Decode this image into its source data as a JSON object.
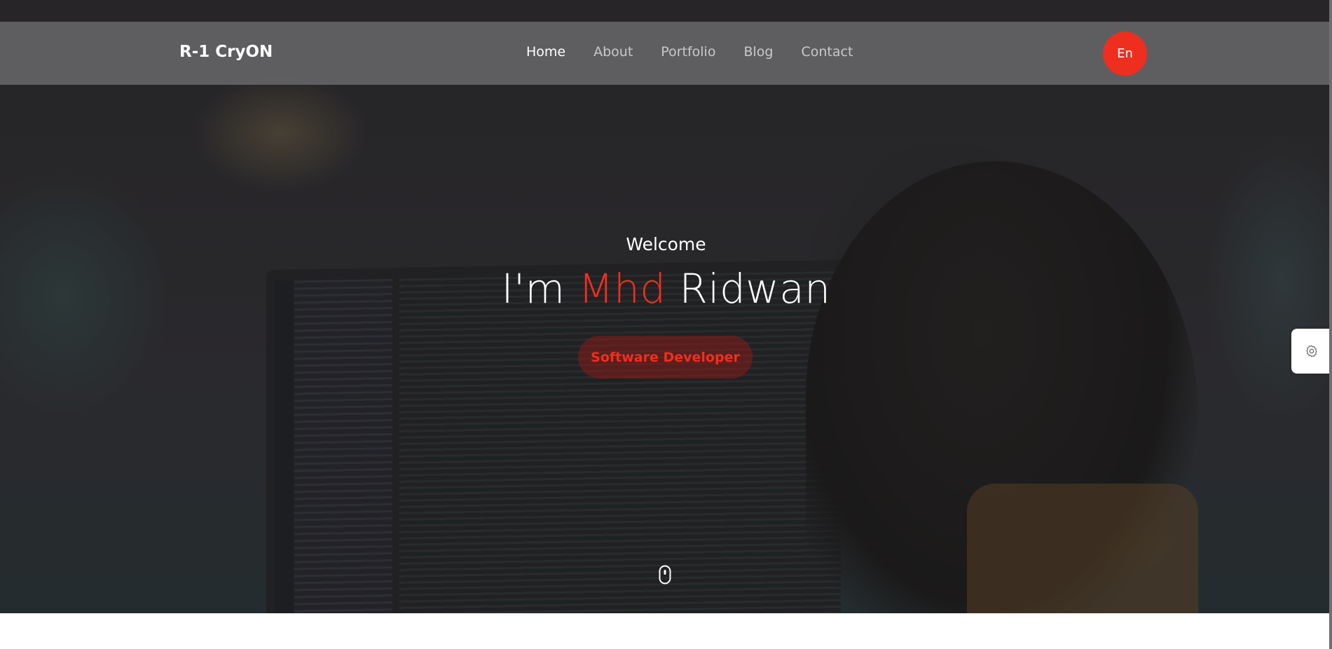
{
  "brand": "R-1 CryON",
  "nav": {
    "items": [
      {
        "label": "Home",
        "active": true
      },
      {
        "label": "About",
        "active": false
      },
      {
        "label": "Portfolio",
        "active": false
      },
      {
        "label": "Blog",
        "active": false
      },
      {
        "label": "Contact",
        "active": false
      }
    ]
  },
  "language_button": "En",
  "hero": {
    "welcome": "Welcome",
    "headline_prefix": "I'm",
    "headline_accent": "Mhd",
    "headline_suffix": "Ridwan",
    "role": "Software Developer"
  },
  "icons": {
    "scroll": "mouse-scroll-icon",
    "settings": "gear-icon"
  },
  "colors": {
    "accent": "#ee2f1f",
    "navbar": "#69696b",
    "text_primary": "#ffffff",
    "text_muted": "#c9c9cb"
  }
}
